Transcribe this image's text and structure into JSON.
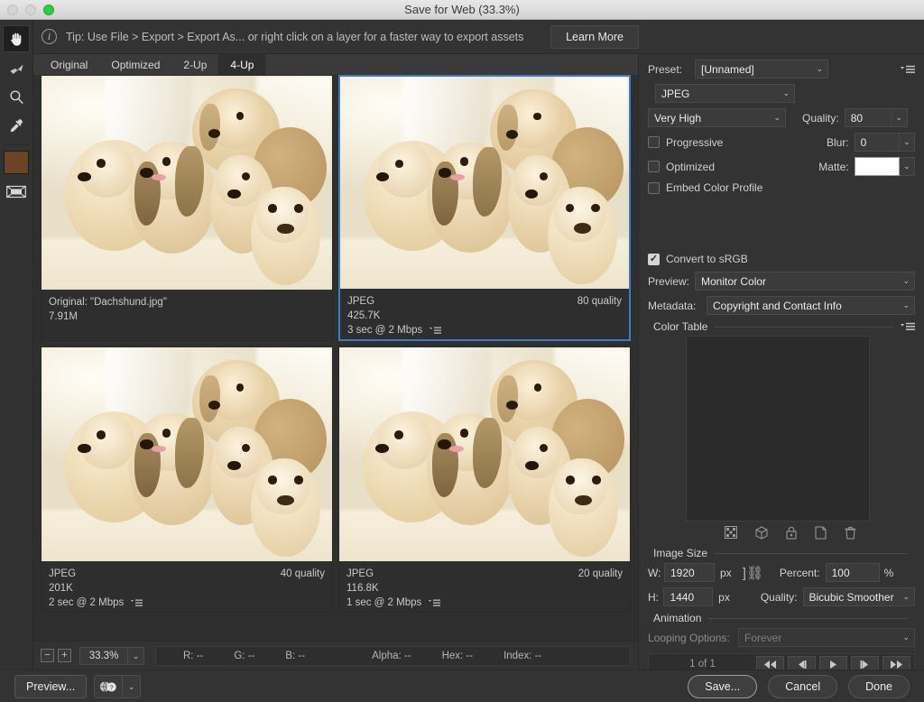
{
  "window": {
    "title": "Save for Web (33.3%)",
    "traffic_lights": [
      "close",
      "minimize",
      "zoom"
    ]
  },
  "tipbar": {
    "icon": "info-icon",
    "text": "Tip: Use File > Export > Export As...  or right click on a layer for a faster way to export assets",
    "learn_more_label": "Learn More"
  },
  "toolbar": {
    "tools": [
      {
        "name": "hand-tool",
        "active": true
      },
      {
        "name": "slice-select-tool",
        "active": false
      },
      {
        "name": "zoom-tool",
        "active": false
      },
      {
        "name": "eyedropper-tool",
        "active": false
      }
    ],
    "swatch_color": "#6b4423",
    "slice_visibility_name": "toggle-slices-visibility"
  },
  "tabs": [
    {
      "label": "Original",
      "active": false
    },
    {
      "label": "Optimized",
      "active": false
    },
    {
      "label": "2-Up",
      "active": false
    },
    {
      "label": "4-Up",
      "active": true
    }
  ],
  "panes": [
    {
      "id": "original",
      "selected": false,
      "title": "Original: \"Dachshund.jpg\"",
      "size": "7.91M",
      "quality": "",
      "speed": ""
    },
    {
      "id": "jpeg-80",
      "selected": true,
      "title": "JPEG",
      "size": "425.7K",
      "quality": "80 quality",
      "speed": "3 sec @ 2 Mbps"
    },
    {
      "id": "jpeg-40",
      "selected": false,
      "title": "JPEG",
      "size": "201K",
      "quality": "40 quality",
      "speed": "2 sec @ 2 Mbps"
    },
    {
      "id": "jpeg-20",
      "selected": false,
      "title": "JPEG",
      "size": "116.8K",
      "quality": "20 quality",
      "speed": "1 sec @ 2 Mbps"
    }
  ],
  "statusbar": {
    "zoom_out": "−",
    "zoom_in": "+",
    "zoom_value": "33.3%",
    "r": "R: --",
    "g": "G: --",
    "b": "B: --",
    "alpha": "Alpha: --",
    "hex": "Hex: --",
    "index": "Index: --"
  },
  "settings": {
    "preset_label": "Preset:",
    "preset_value": "[Unnamed]",
    "format_value": "JPEG",
    "compression_value": "Very High",
    "quality_label": "Quality:",
    "quality_value": "80",
    "progressive_label": "Progressive",
    "progressive_checked": false,
    "blur_label": "Blur:",
    "blur_value": "0",
    "optimized_label": "Optimized",
    "optimized_checked": false,
    "matte_label": "Matte:",
    "matte_color": "#ffffff",
    "embed_profile_label": "Embed Color Profile",
    "embed_profile_checked": false,
    "convert_srgb_label": "Convert to sRGB",
    "convert_srgb_checked": true,
    "preview_label": "Preview:",
    "preview_value": "Monitor Color",
    "metadata_label": "Metadata:",
    "metadata_value": "Copyright and Contact Info",
    "color_table_label": "Color Table",
    "color_table_icons": [
      "dither-transparency-icon",
      "web-safe-cube-icon",
      "lock-icon",
      "new-swatch-icon",
      "delete-swatch-icon"
    ]
  },
  "image_size": {
    "section_label": "Image Size",
    "w_label": "W:",
    "w_value": "1920",
    "w_unit": "px",
    "h_label": "H:",
    "h_value": "1440",
    "h_unit": "px",
    "link_icon": "chain-link-icon",
    "percent_label": "Percent:",
    "percent_value": "100",
    "percent_unit": "%",
    "quality_label": "Quality:",
    "quality_value": "Bicubic Smoother"
  },
  "animation": {
    "section_label": "Animation",
    "looping_label": "Looping Options:",
    "looping_value": "Forever",
    "frame_counter": "1 of 1",
    "buttons": [
      "first-frame-button",
      "previous-frame-button",
      "play-button",
      "next-frame-button",
      "last-frame-button"
    ]
  },
  "footer": {
    "preview_label": "Preview...",
    "browser_icon": "browser-preview-icon",
    "save_label": "Save...",
    "cancel_label": "Cancel",
    "done_label": "Done"
  },
  "colors": {
    "accent": "#3b7cc4",
    "panel_bg": "#333333",
    "canvas_bg": "#2f2f2f"
  }
}
